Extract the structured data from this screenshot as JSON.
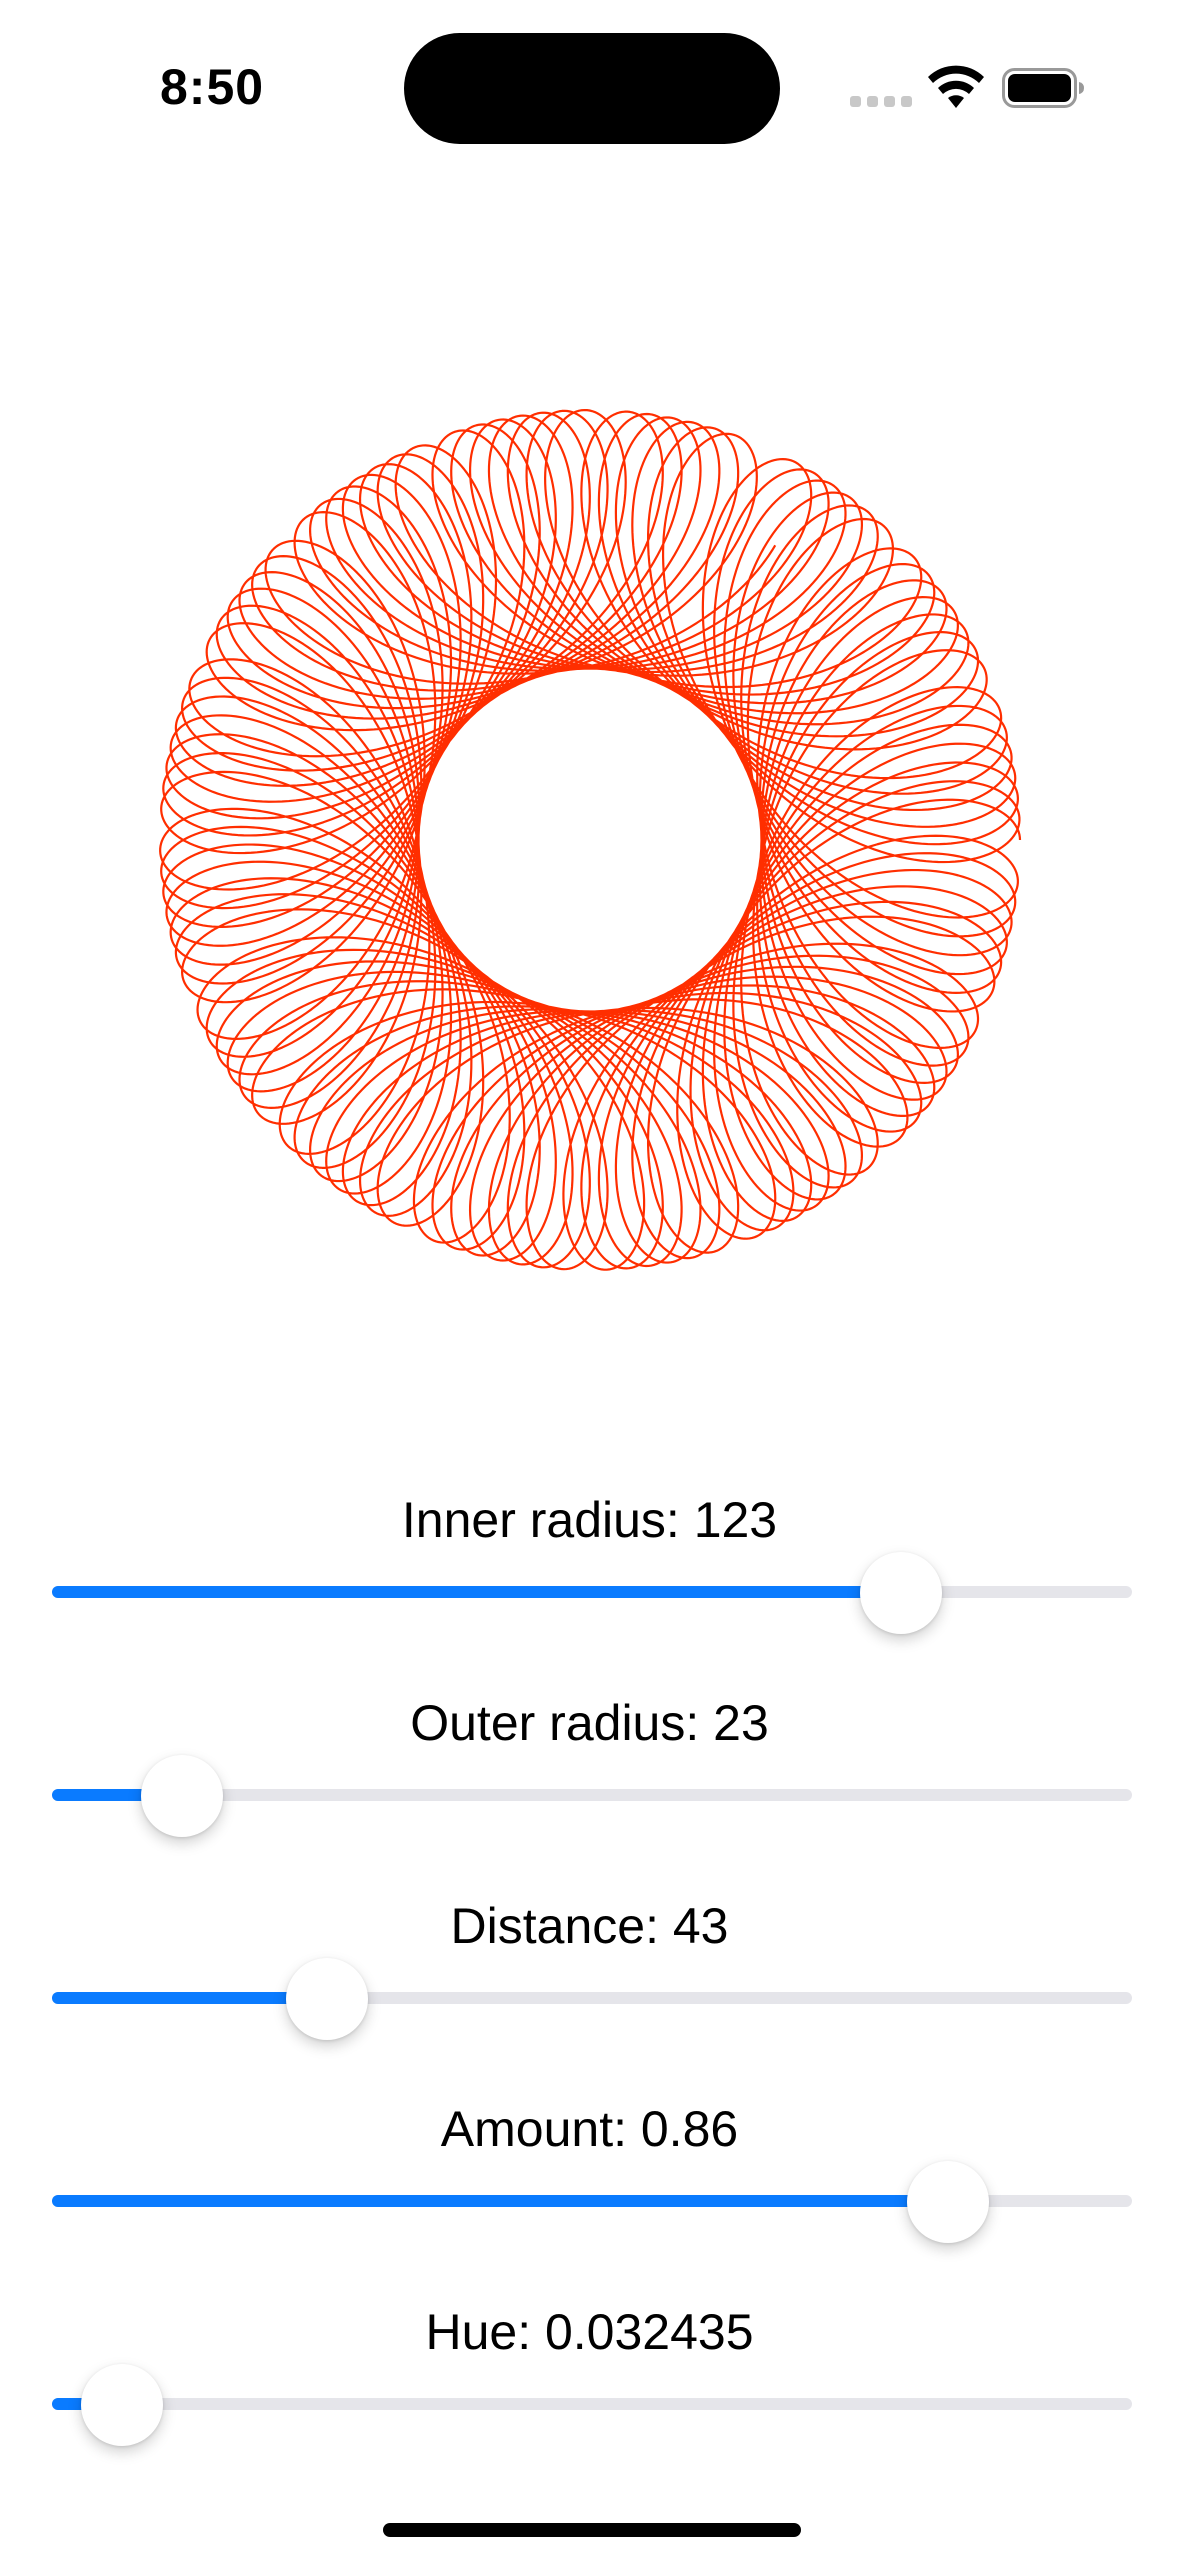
{
  "status_bar": {
    "time": "8:50",
    "icons": [
      "signal-icon",
      "wifi-icon",
      "battery-icon"
    ]
  },
  "spirograph": {
    "stroke_color": "#ff2e00",
    "inner_radius": 123,
    "outer_radius": 23,
    "distance": 43,
    "amount": 0.86,
    "hue": 0.032435
  },
  "controls": [
    {
      "id": "inner-radius",
      "label": "Inner radius: 123",
      "fraction": 0.786
    },
    {
      "id": "outer-radius",
      "label": "Outer radius: 23",
      "fraction": 0.12
    },
    {
      "id": "distance",
      "label": "Distance: 43",
      "fraction": 0.255
    },
    {
      "id": "amount",
      "label": "Amount: 0.86",
      "fraction": 0.83
    },
    {
      "id": "hue",
      "label": "Hue: 0.032435",
      "fraction": 0.065
    }
  ],
  "colors": {
    "accent": "#0a7bff",
    "track": "#e5e5ea",
    "spiro": "#ff2e00"
  }
}
